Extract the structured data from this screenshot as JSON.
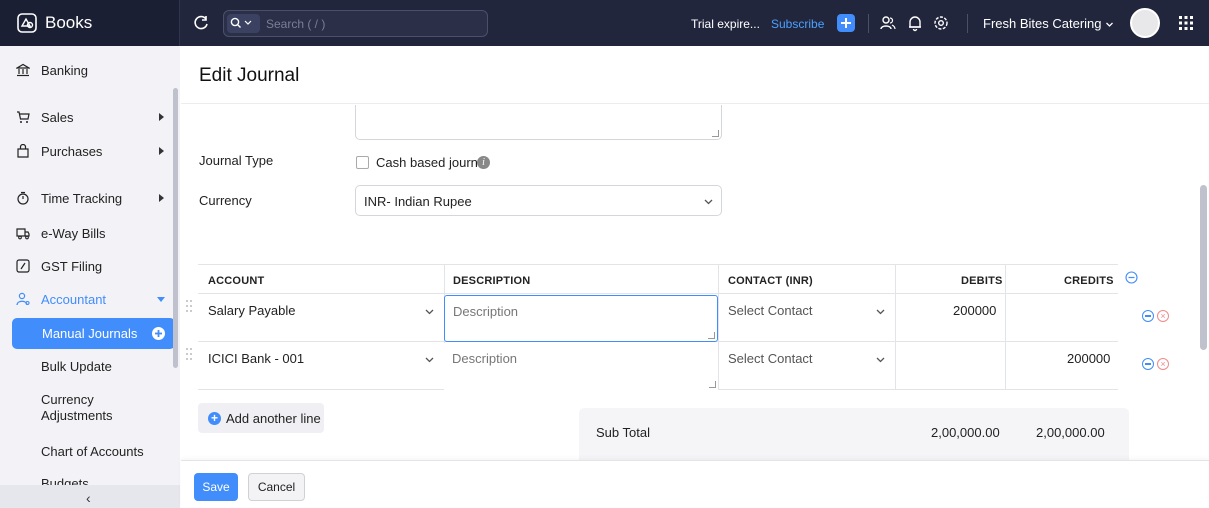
{
  "app": {
    "name": "Books",
    "logo_icon": "books-logo-icon"
  },
  "topbar": {
    "search_placeholder": "Search ( / )",
    "trial_text": "Trial expire...",
    "subscribe_label": "Subscribe",
    "org_name": "Fresh Bites Catering",
    "icons": [
      "refresh-icon",
      "search-icon",
      "add-icon",
      "users-icon",
      "bell-icon",
      "settings-icon",
      "apps-grid-icon"
    ]
  },
  "sidebar": {
    "items": [
      {
        "label": "Banking",
        "icon": "bank-icon"
      },
      {
        "label": "Sales",
        "icon": "cart-icon"
      },
      {
        "label": "Purchases",
        "icon": "bag-icon"
      },
      {
        "label": "Time Tracking",
        "icon": "stopwatch-icon"
      },
      {
        "label": "e-Way Bills",
        "icon": "truck-icon"
      },
      {
        "label": "GST Filing",
        "icon": "gst-icon"
      },
      {
        "label": "Accountant",
        "icon": "accountant-icon"
      }
    ],
    "sub_items": {
      "manual_journals": "Manual Journals",
      "bulk_update": "Bulk Update",
      "currency_adjustments": "Currency Adjustments",
      "chart_of_accounts": "Chart of Accounts",
      "budgets": "Budgets"
    },
    "collapse_glyph": "‹"
  },
  "page": {
    "title": "Edit Journal",
    "journal_type_label": "Journal Type",
    "cash_based_label": "Cash based journal",
    "currency_label": "Currency",
    "currency_value": "INR- Indian Rupee"
  },
  "table": {
    "headers": {
      "account": "ACCOUNT",
      "description": "DESCRIPTION",
      "contact": "CONTACT (INR)",
      "debits": "DEBITS",
      "credits": "CREDITS"
    },
    "rows": [
      {
        "account": "Salary Payable",
        "description_placeholder": "Description",
        "contact": "Select Contact",
        "debit": "200000",
        "credit": ""
      },
      {
        "account": "ICICI Bank - 001",
        "description_placeholder": "Description",
        "contact": "Select Contact",
        "debit": "",
        "credit": "200000"
      }
    ]
  },
  "add_line_label": "Add another line",
  "subtotal": {
    "label": "Sub Total",
    "debits": "2,00,000.00",
    "credits": "2,00,000.00"
  },
  "footer": {
    "save_label": "Save",
    "cancel_label": "Cancel"
  },
  "colors": {
    "accent": "#408dfb",
    "topbar": "#21263c",
    "sidebar": "#f3f3f7"
  }
}
